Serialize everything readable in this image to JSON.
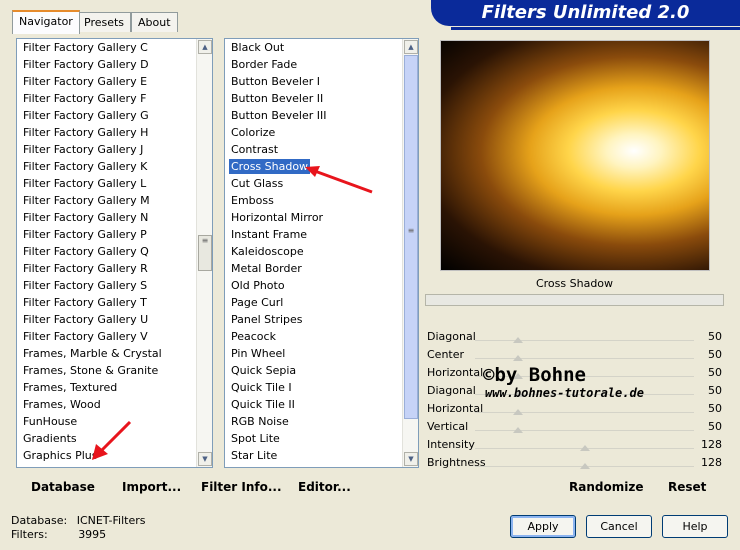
{
  "tabs": [
    "Navigator",
    "Presets",
    "About"
  ],
  "app_title": "Filters Unlimited 2.0",
  "categories": [
    "Filter Factory Gallery C",
    "Filter Factory Gallery D",
    "Filter Factory Gallery E",
    "Filter Factory Gallery F",
    "Filter Factory Gallery G",
    "Filter Factory Gallery H",
    "Filter Factory Gallery J",
    "Filter Factory Gallery K",
    "Filter Factory Gallery L",
    "Filter Factory Gallery M",
    "Filter Factory Gallery N",
    "Filter Factory Gallery P",
    "Filter Factory Gallery Q",
    "Filter Factory Gallery R",
    "Filter Factory Gallery S",
    "Filter Factory Gallery T",
    "Filter Factory Gallery U",
    "Filter Factory Gallery V",
    "Frames, Marble & Crystal",
    "Frames, Stone & Granite",
    "Frames, Textured",
    "Frames, Wood",
    "FunHouse",
    "Gradients",
    "Graphics Plus"
  ],
  "filters": [
    "Black Out",
    "Border Fade",
    "Button Beveler I",
    "Button Beveler II",
    "Button Beveler III",
    "Colorize",
    "Contrast",
    "Cross Shadow",
    "Cut Glass",
    "Emboss",
    "Horizontal Mirror",
    "Instant Frame",
    "Kaleidoscope",
    "Metal Border",
    "Old Photo",
    "Page Curl",
    "Panel Stripes",
    "Peacock",
    "Pin Wheel",
    "Quick Sepia",
    "Quick Tile I",
    "Quick Tile II",
    "RGB Noise",
    "Spot Lite",
    "Star Lite"
  ],
  "selected_filter": "Cross Shadow",
  "preview_caption": "Cross Shadow",
  "params": [
    {
      "name": "Diagonal",
      "value": "50"
    },
    {
      "name": "Center",
      "value": "50"
    },
    {
      "name": "Horizontal",
      "value": "50"
    },
    {
      "name": "Diagonal",
      "value": "50"
    },
    {
      "name": "Horizontal",
      "value": "50"
    },
    {
      "name": "Vertical",
      "value": "50"
    },
    {
      "name": "Intensity",
      "value": "128"
    },
    {
      "name": "Brightness",
      "value": "128"
    }
  ],
  "watermark": {
    "line1": "©by Bohne",
    "line2": "www.bohnes-tutorale.de"
  },
  "toolbar": {
    "database": "Database",
    "import": "Import...",
    "filter_info": "Filter Info...",
    "editor": "Editor...",
    "randomize": "Randomize",
    "reset": "Reset"
  },
  "info": {
    "database_label": "Database:",
    "database_value": "ICNET-Filters",
    "filters_label": "Filters:",
    "filters_value": "3995"
  },
  "buttons": {
    "apply": "Apply",
    "cancel": "Cancel",
    "help": "Help"
  },
  "colors": {
    "selection": "#316ac5",
    "title_bar": "#0a2a9a",
    "arrow": "#e8141c"
  }
}
